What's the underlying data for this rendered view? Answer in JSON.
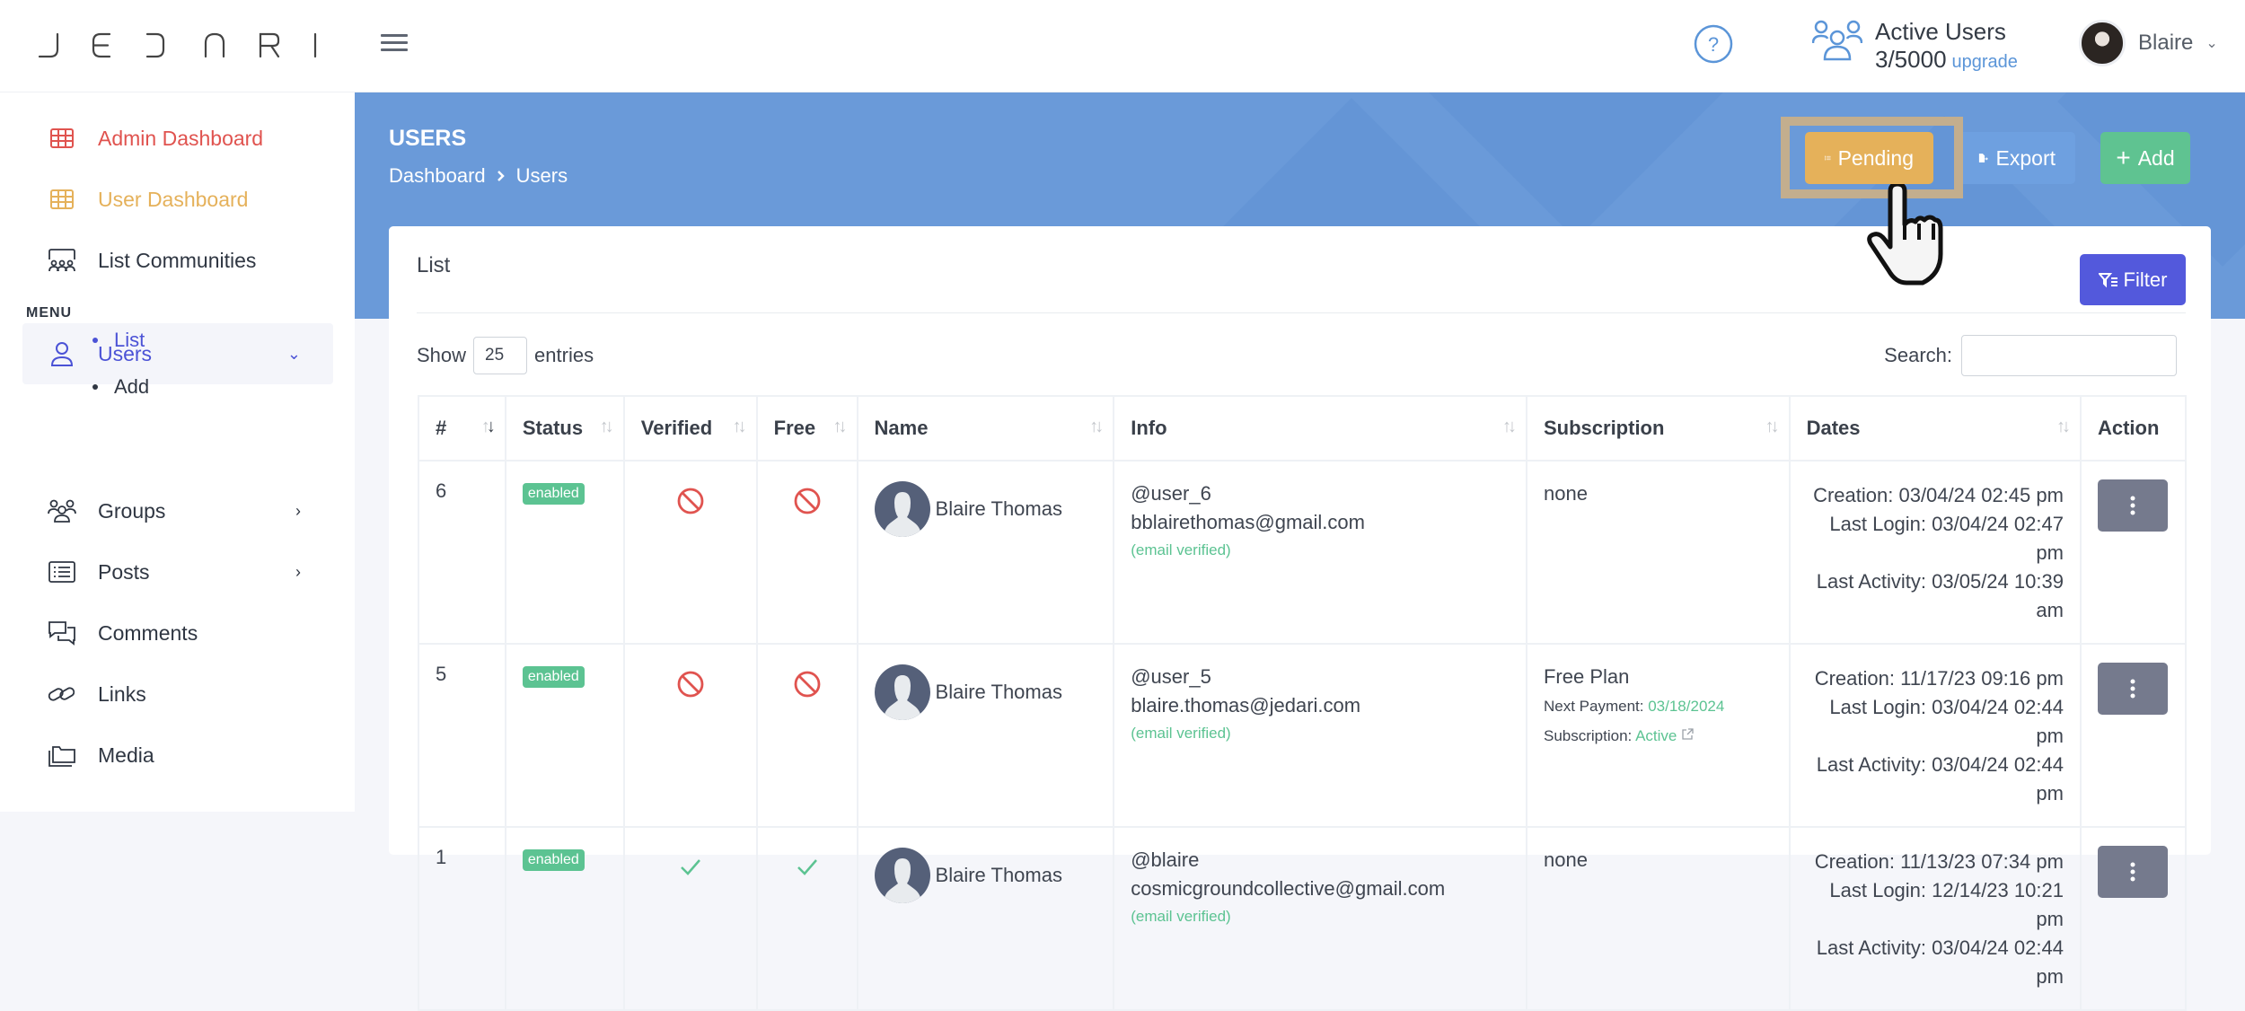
{
  "app": {
    "logo_text": "JEDARI"
  },
  "header": {
    "help_icon": "question-circle-icon",
    "active_users_title": "Active Users",
    "active_users_count": "3/5000",
    "upgrade_label": "upgrade",
    "user_name": "Blaire"
  },
  "sidebar": {
    "top_items": [
      {
        "label": "Admin Dashboard",
        "icon": "grid-icon",
        "color": "#e0534f"
      },
      {
        "label": "User Dashboard",
        "icon": "grid-icon",
        "color": "#e5b15a"
      },
      {
        "label": "List Communities",
        "icon": "communities-icon",
        "color": "#2f3642"
      }
    ],
    "menu_label": "MENU",
    "menu_items": [
      {
        "label": "Users",
        "icon": "user-icon",
        "expanded": true,
        "active": true
      },
      {
        "label": "Groups",
        "icon": "groups-icon",
        "has_children": true
      },
      {
        "label": "Posts",
        "icon": "posts-icon",
        "has_children": true
      },
      {
        "label": "Comments",
        "icon": "comments-icon"
      },
      {
        "label": "Links",
        "icon": "link-icon"
      },
      {
        "label": "Media",
        "icon": "folder-icon"
      }
    ],
    "users_subitems": [
      {
        "label": "List",
        "active": true
      },
      {
        "label": "Add",
        "active": false
      }
    ]
  },
  "page": {
    "title": "USERS",
    "breadcrumb": [
      "Dashboard",
      "Users"
    ],
    "buttons": {
      "pending": "Pending",
      "export": "Export",
      "add": "Add"
    },
    "colors": {
      "banner": "#6a9ad9",
      "pending": "#e5b15a",
      "export": "#6ea0e0",
      "add": "#5fc391",
      "filter": "#5359dc"
    }
  },
  "card": {
    "title": "List",
    "filter_label": "Filter",
    "show_label": "Show",
    "entries_value": "25",
    "entries_label": "entries",
    "search_label": "Search:",
    "search_value": ""
  },
  "table": {
    "columns": [
      "#",
      "Status",
      "Verified",
      "Free",
      "Name",
      "Info",
      "Subscription",
      "Dates",
      "Action"
    ],
    "rows": [
      {
        "id": "6",
        "status": "enabled",
        "verified": false,
        "free": false,
        "name": "Blaire Thomas",
        "username": "@user_6",
        "email": "bblairethomas@gmail.com",
        "email_status": "(email verified)",
        "subscription": {
          "plan": "none"
        },
        "creation": "Creation: 03/04/24 02:45 pm",
        "last_login": "Last Login: 03/04/24 02:47 pm",
        "last_activity": "Last Activity: 03/05/24 10:39 am"
      },
      {
        "id": "5",
        "status": "enabled",
        "verified": false,
        "free": false,
        "name": "Blaire Thomas",
        "username": "@user_5",
        "email": "blaire.thomas@jedari.com",
        "email_status": "(email verified)",
        "subscription": {
          "plan": "Free Plan",
          "next_payment_label": "Next Payment:",
          "next_payment": "03/18/2024",
          "subscription_label": "Subscription:",
          "subscription_status": "Active"
        },
        "creation": "Creation: 11/17/23 09:16 pm",
        "last_login": "Last Login: 03/04/24 02:44 pm",
        "last_activity": "Last Activity: 03/04/24 02:44 pm"
      },
      {
        "id": "1",
        "status": "enabled",
        "verified": true,
        "free": true,
        "name": "Blaire Thomas",
        "username": "@blaire",
        "email": "cosmicgroundcollective@gmail.com",
        "email_status": "(email verified)",
        "subscription": {
          "plan": "none"
        },
        "creation": "Creation: 11/13/23 07:34 pm",
        "last_login": "Last Login: 12/14/23 10:21 pm",
        "last_activity": "Last Activity: 03/04/24 02:44 pm"
      }
    ]
  }
}
